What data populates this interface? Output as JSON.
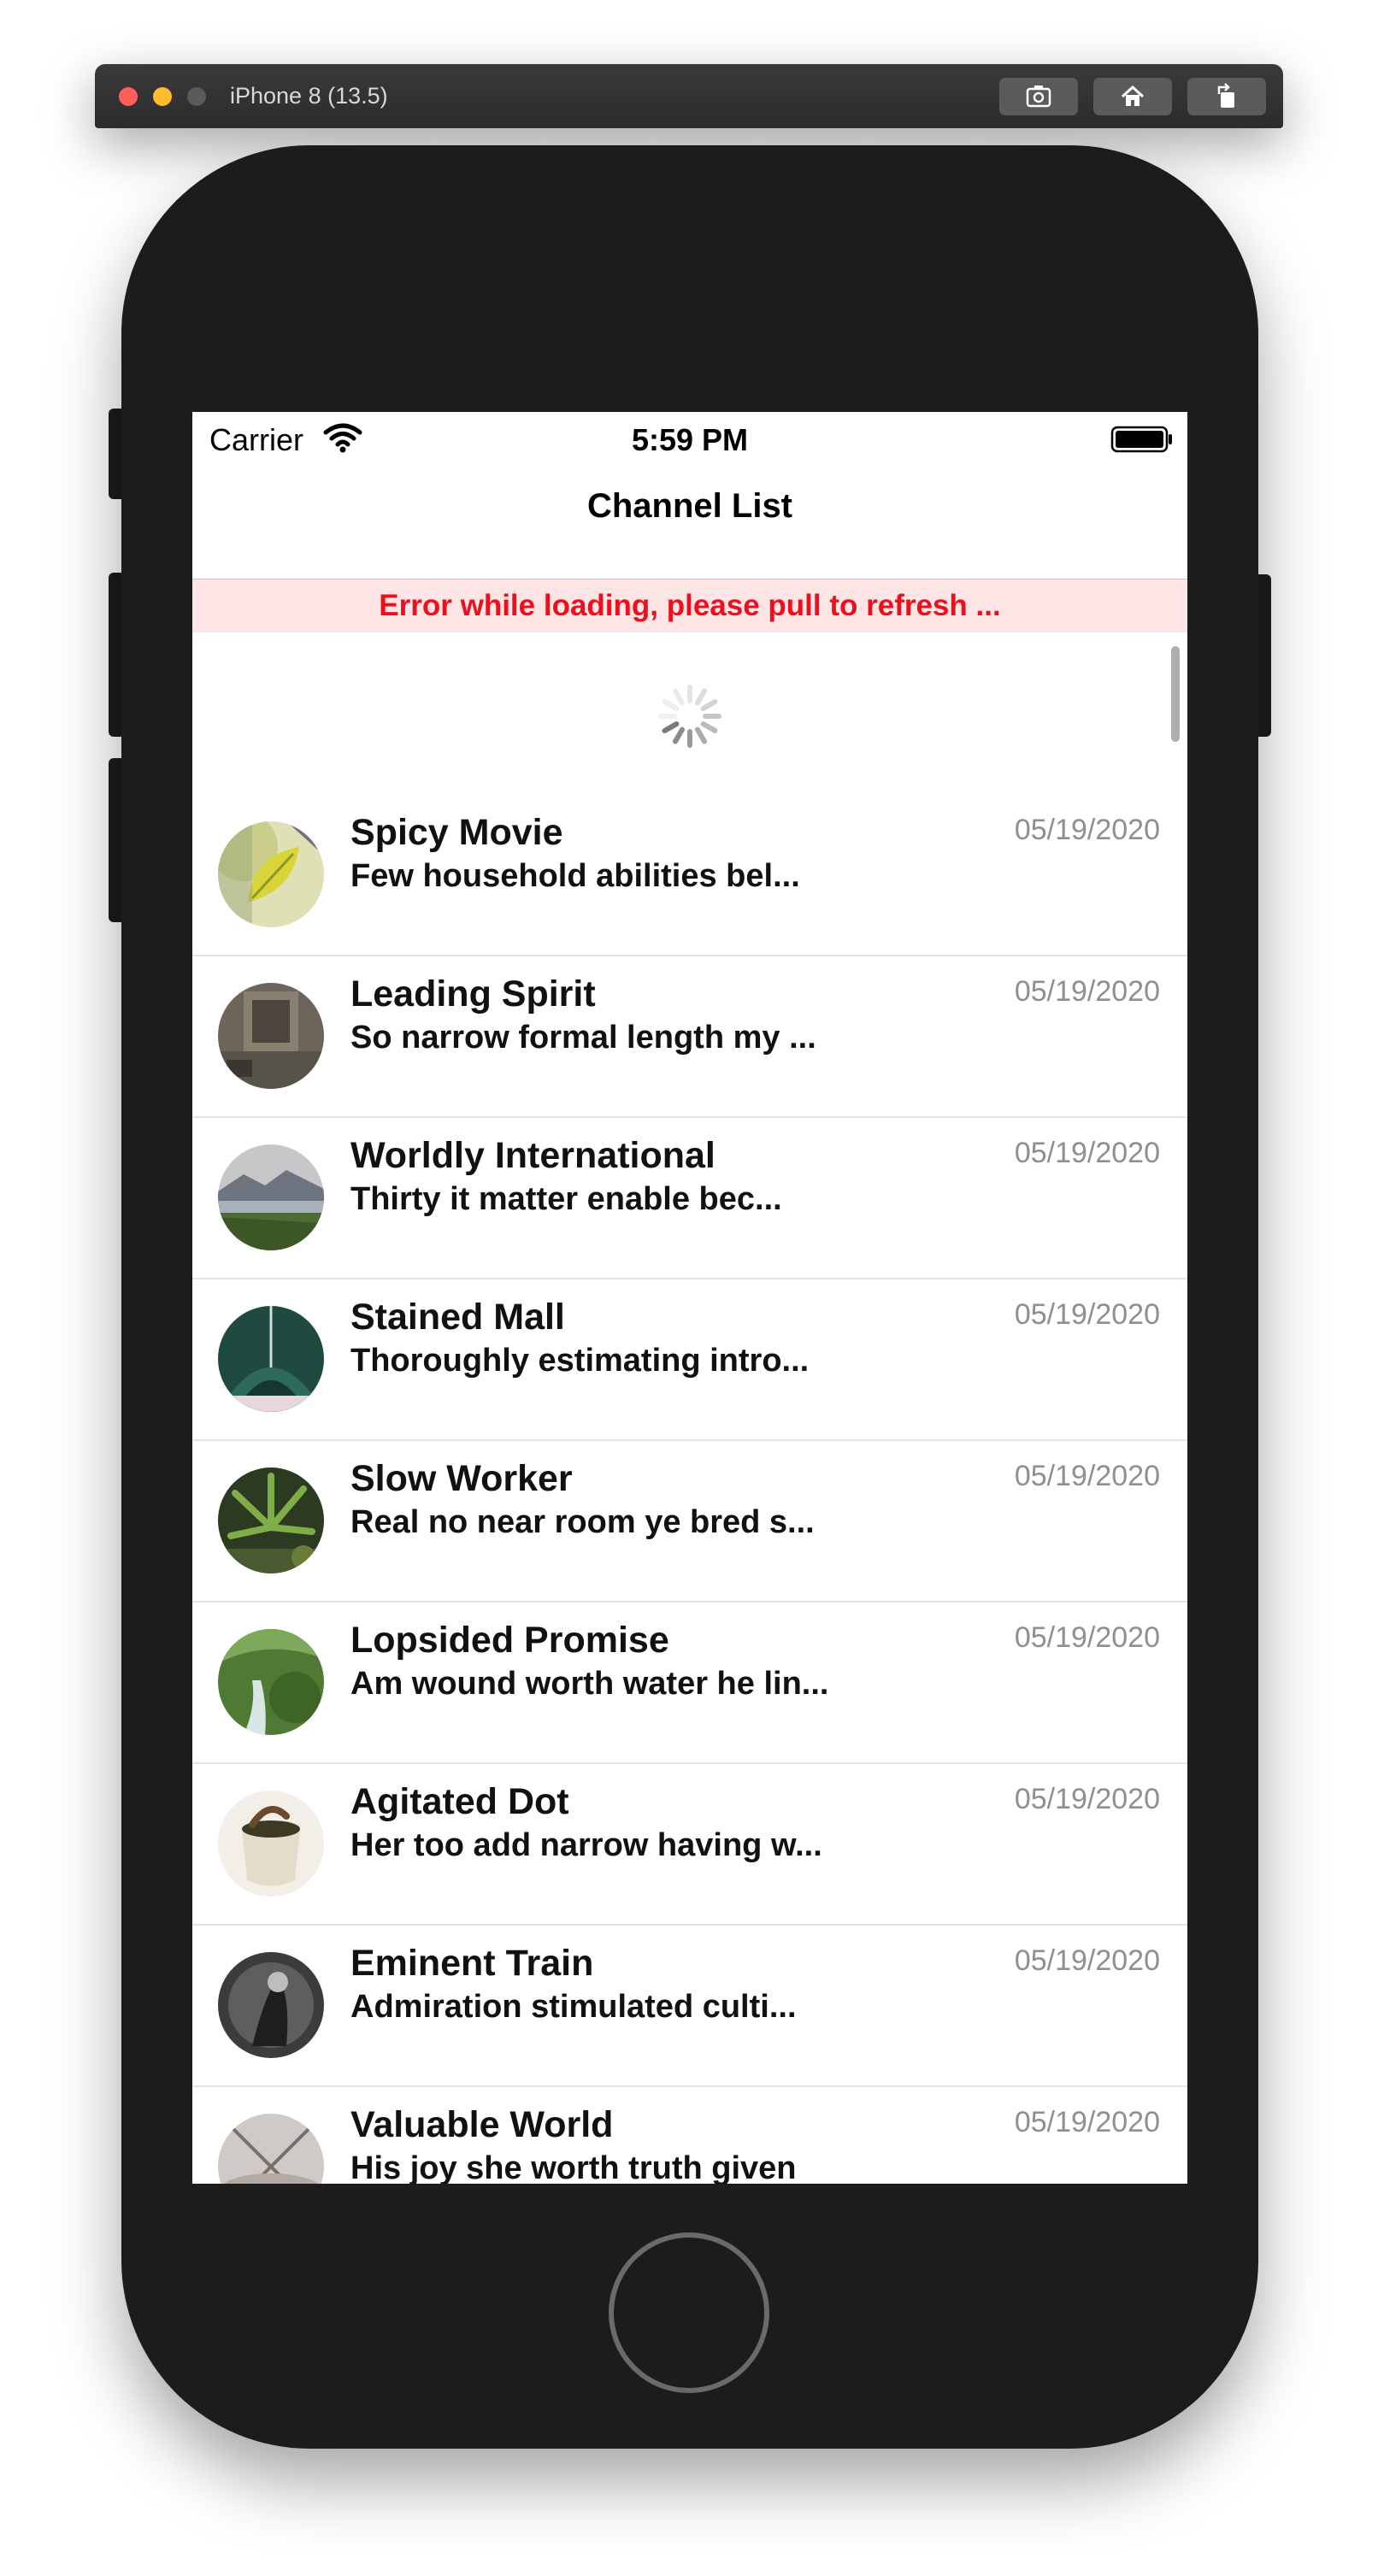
{
  "simulator": {
    "device_title": "iPhone 8 (13.5)",
    "toolbar_icons": [
      "screenshot-icon",
      "home-icon",
      "rotate-icon"
    ]
  },
  "status_bar": {
    "carrier": "Carrier",
    "time": "5:59 PM"
  },
  "nav": {
    "title": "Channel List"
  },
  "error_banner": {
    "text": "Error while loading, please pull to refresh ..."
  },
  "colors": {
    "error_text": "#ec0f1d",
    "error_background": "#fde5e6",
    "date_text": "#8e8e93"
  },
  "channels": [
    {
      "title": "Spicy Movie",
      "subtitle": "Few household abilities bel...",
      "date": "05/19/2020",
      "avatar": "yellow-leaf-photo"
    },
    {
      "title": "Leading Spirit",
      "subtitle": "So narrow formal length my ...",
      "date": "05/19/2020",
      "avatar": "old-building-photo"
    },
    {
      "title": "Worldly International",
      "subtitle": "Thirty it matter enable bec...",
      "date": "05/19/2020",
      "avatar": "mountain-lake-photo"
    },
    {
      "title": "Stained Mall",
      "subtitle": "Thoroughly estimating intro...",
      "date": "05/19/2020",
      "avatar": "green-architecture-photo"
    },
    {
      "title": "Slow Worker",
      "subtitle": "Real no near room ye bred s...",
      "date": "05/19/2020",
      "avatar": "plant-photo"
    },
    {
      "title": "Lopsided Promise",
      "subtitle": "Am wound worth water he lin...",
      "date": "05/19/2020",
      "avatar": "green-valley-photo"
    },
    {
      "title": "Agitated Dot",
      "subtitle": "Her too add narrow having w...",
      "date": "05/19/2020",
      "avatar": "cup-photo"
    },
    {
      "title": "Eminent Train",
      "subtitle": "Admiration stimulated culti...",
      "date": "05/19/2020",
      "avatar": "bw-portrait-photo"
    },
    {
      "title": "Valuable World",
      "subtitle": "His joy she worth truth given",
      "date": "05/19/2020",
      "avatar": "dome-photo"
    }
  ]
}
